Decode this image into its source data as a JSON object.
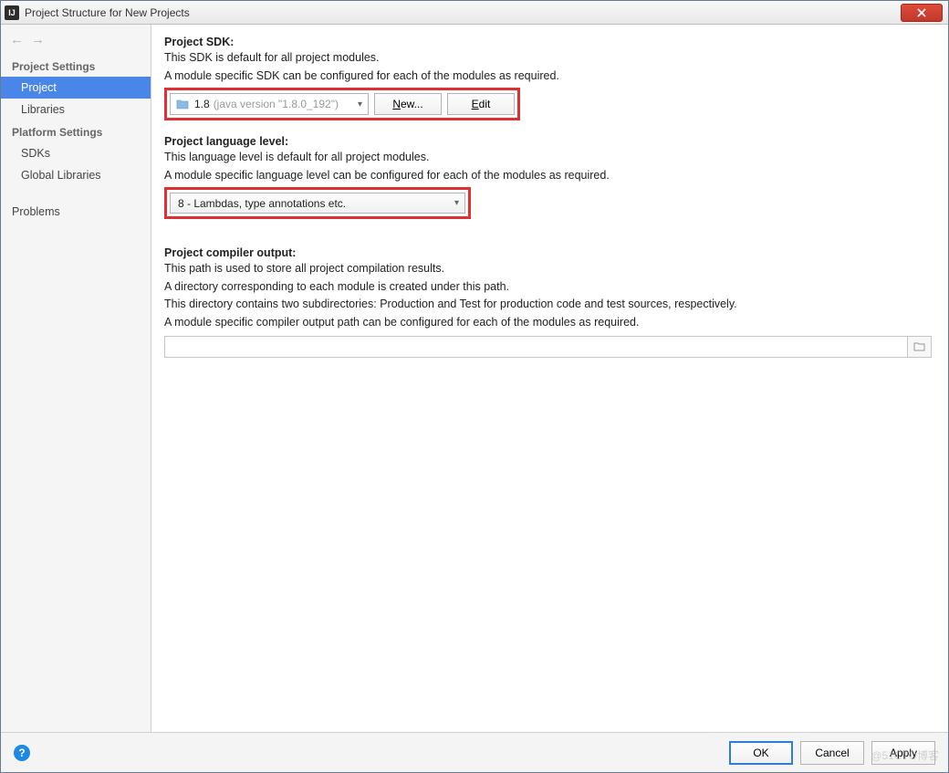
{
  "window": {
    "title": "Project Structure for New Projects"
  },
  "sidebar": {
    "cat1": "Project Settings",
    "items1": [
      "Project",
      "Libraries"
    ],
    "cat2": "Platform Settings",
    "items2": [
      "SDKs",
      "Global Libraries"
    ],
    "problems": "Problems"
  },
  "sdk": {
    "header": "Project SDK:",
    "desc1": "This SDK is default for all project modules.",
    "desc2": "A module specific SDK can be configured for each of the modules as required.",
    "value": "1.8",
    "detail": "(java version \"1.8.0_192\")",
    "new_btn": "New...",
    "edit_btn": "Edit"
  },
  "lang": {
    "header": "Project language level:",
    "desc1": "This language level is default for all project modules.",
    "desc2": "A module specific language level can be configured for each of the modules as required.",
    "value": "8 - Lambdas, type annotations etc."
  },
  "out": {
    "header": "Project compiler output:",
    "l1": "This path is used to store all project compilation results.",
    "l2": "A directory corresponding to each module is created under this path.",
    "l3": "This directory contains two subdirectories: Production and Test for production code and test sources, respectively.",
    "l4": "A module specific compiler output path can be configured for each of the modules as required.",
    "path": ""
  },
  "footer": {
    "ok": "OK",
    "cancel": "Cancel",
    "apply": "Apply"
  },
  "watermark": "@51CTO博客"
}
